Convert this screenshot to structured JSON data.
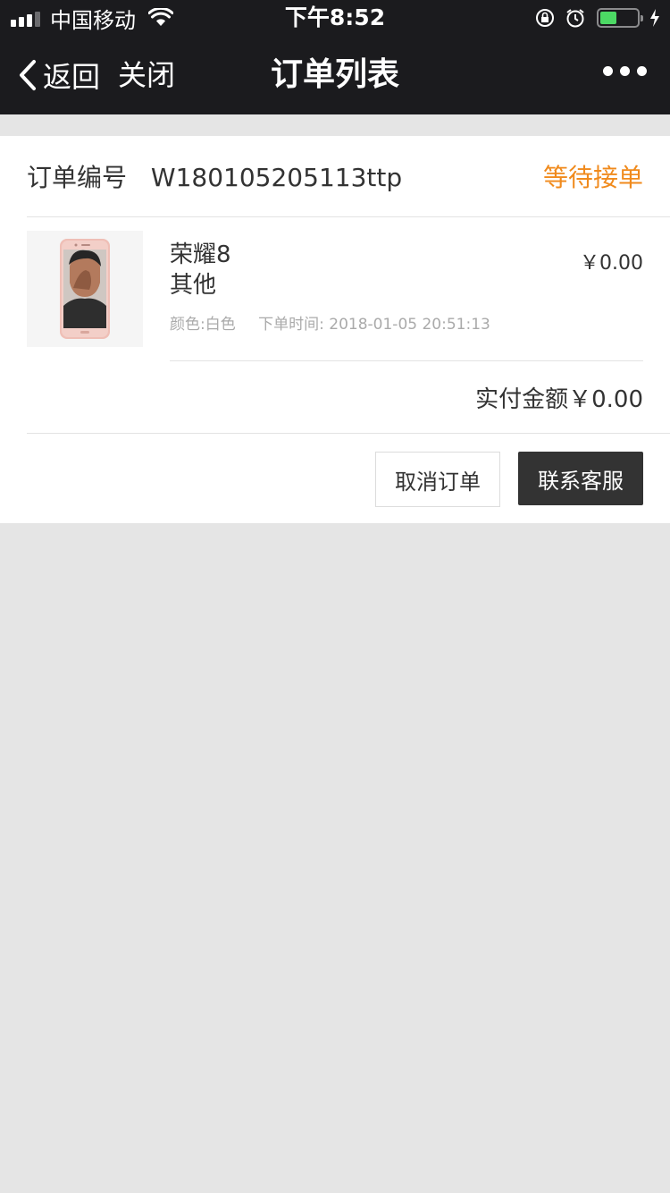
{
  "status_bar": {
    "carrier": "中国移动",
    "time": "下午8:52",
    "battery_level": 0.45,
    "battery_color": "#4cd964",
    "icons": [
      "signal-icon",
      "wifi-icon",
      "rotation-lock-icon",
      "alarm-icon",
      "battery-icon",
      "charging-icon"
    ]
  },
  "nav": {
    "back_label": "返回",
    "close_label": "关闭",
    "title": "订单列表",
    "more_icon": "more-icon"
  },
  "order": {
    "number_label": "订单编号",
    "number": "W180105205113ttp",
    "status": "等待接单",
    "status_color": "#f08a1c",
    "product": {
      "name": "荣耀8",
      "spec": "其他",
      "price": "￥0.00",
      "color_text": "颜色:白色",
      "time_label": "下单时间:",
      "time_value": "2018-01-05 20:51:13"
    },
    "paid_label": "实付金额",
    "paid_amount": "￥0.00",
    "actions": {
      "cancel_label": "取消订单",
      "service_label": "联系客服"
    }
  }
}
